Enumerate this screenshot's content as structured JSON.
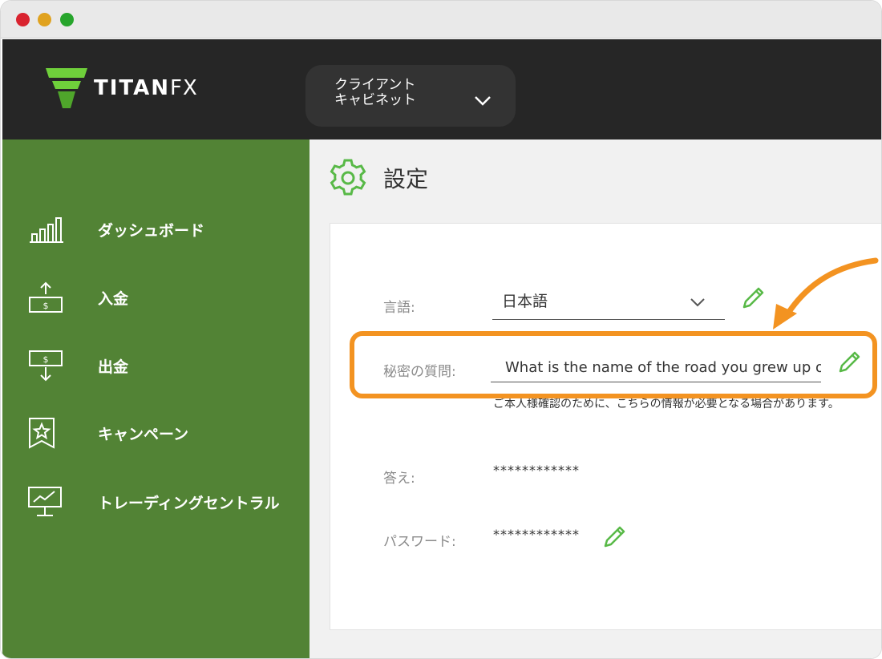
{
  "colors": {
    "topbar_bg": "#262626",
    "sidebar_bg": "#528335",
    "accent_green": "#58b947",
    "highlight_orange": "#f39321"
  },
  "window": {
    "controls": [
      "close",
      "minimize",
      "maximize"
    ]
  },
  "header": {
    "logo": "TITANFX",
    "cabinet_label": "クライアント\nキャビネット",
    "cabinet_icon": "chevron-down-icon"
  },
  "sidebar": {
    "items": [
      {
        "label": "ダッシュボード",
        "icon": "bar-chart-icon"
      },
      {
        "label": "入金",
        "icon": "deposit-icon"
      },
      {
        "label": "出金",
        "icon": "withdraw-icon"
      },
      {
        "label": "キャンペーン",
        "icon": "campaign-star-icon"
      },
      {
        "label": "トレーディングセントラル",
        "icon": "trading-central-icon"
      }
    ]
  },
  "page": {
    "title": "設定",
    "icon": "gear-icon"
  },
  "settings": {
    "language": {
      "label": "言語:",
      "value": "日本語"
    },
    "secret_question": {
      "label": "秘密の質問:",
      "value": "What is the name of the road you grew up on?",
      "hint": "ご本人様確認のために、こちらの情報が必要となる場合があります。"
    },
    "answer": {
      "label": "答え:",
      "value": "************"
    },
    "password": {
      "label": "パスワード:",
      "value": "************"
    }
  }
}
